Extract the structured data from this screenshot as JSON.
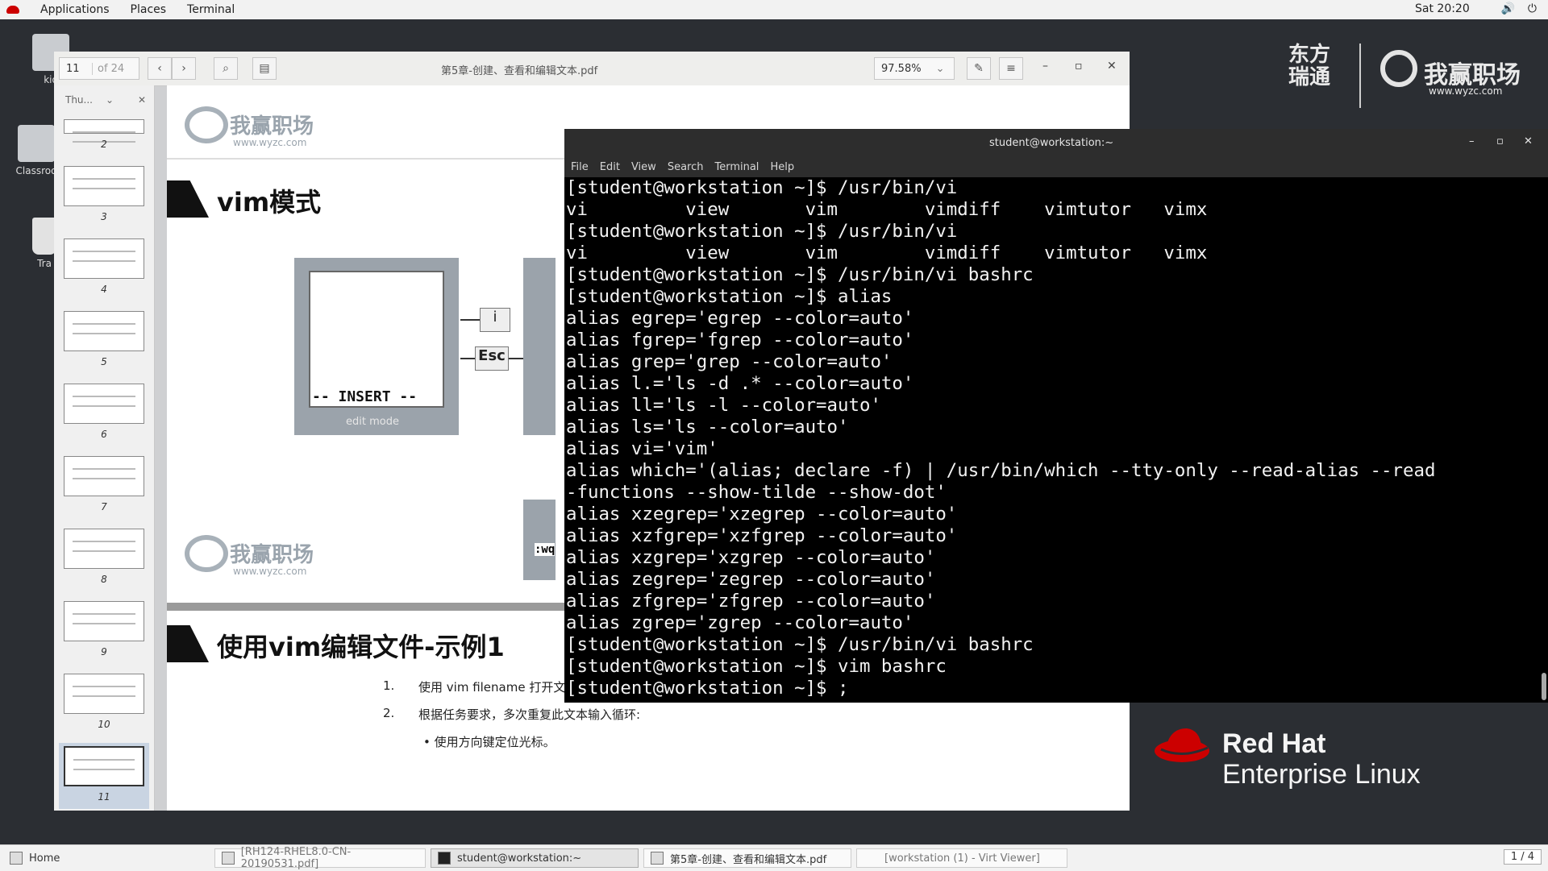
{
  "topbar": {
    "applications": "Applications",
    "places": "Places",
    "terminal": "Terminal",
    "clock": "Sat 20:20"
  },
  "desktop": {
    "icons": [
      "kio",
      "Classroo",
      "Tra"
    ]
  },
  "pdf": {
    "page_number": "11",
    "page_total": "of 24",
    "title": "第5章-创建、查看和编辑文本.pdf",
    "zoom": "97.58%",
    "sidebar_label": "Thu...",
    "thumb_numbers": [
      "2",
      "3",
      "4",
      "5",
      "6",
      "7",
      "8",
      "9",
      "10",
      "11"
    ],
    "watermark": "我赢职场",
    "watermark_url": "www.wyzc.com",
    "slide1_title": "vim模式",
    "insert_label": "-- INSERT --",
    "edit_mode": "edit mode",
    "key_i": "i",
    "key_esc": "Esc",
    "wq_label": ":wq",
    "slide2_title": "使用vim编辑文件-示例1",
    "step1_num": "1.",
    "step1": "使用 vim filename 打开文件。",
    "step2_num": "2.",
    "step2": "根据任务要求，多次重复此文本输入循环:",
    "step2_bullet": "• 使用方向键定位光标。"
  },
  "terminal": {
    "title": "student@workstation:~",
    "menu": [
      "File",
      "Edit",
      "View",
      "Search",
      "Terminal",
      "Help"
    ],
    "lines": [
      "[student@workstation ~]$ /usr/bin/vi",
      "vi         view       vim        vimdiff    vimtutor   vimx",
      "[student@workstation ~]$ /usr/bin/vi",
      "vi         view       vim        vimdiff    vimtutor   vimx",
      "[student@workstation ~]$ /usr/bin/vi bashrc",
      "[student@workstation ~]$ alias",
      "alias egrep='egrep --color=auto'",
      "alias fgrep='fgrep --color=auto'",
      "alias grep='grep --color=auto'",
      "alias l.='ls -d .* --color=auto'",
      "alias ll='ls -l --color=auto'",
      "alias ls='ls --color=auto'",
      "alias vi='vim'",
      "alias which='(alias; declare -f) | /usr/bin/which --tty-only --read-alias --read",
      "-functions --show-tilde --show-dot'",
      "alias xzegrep='xzegrep --color=auto'",
      "alias xzfgrep='xzfgrep --color=auto'",
      "alias xzgrep='xzgrep --color=auto'",
      "alias zegrep='zegrep --color=auto'",
      "alias zfgrep='zfgrep --color=auto'",
      "alias zgrep='zgrep --color=auto'",
      "[student@workstation ~]$ /usr/bin/vi bashrc",
      "[student@workstation ~]$ vim bashrc",
      "[student@workstation ~]$ ;"
    ]
  },
  "branding": {
    "cn1": "东方",
    "cn2": "瑞通",
    "cn3": "我赢职场",
    "cn_url": "www.wyzc.com",
    "rh_line1": "Red Hat",
    "rh_line2": "Enterprise Linux"
  },
  "taskbar": {
    "home": "Home",
    "tasks": [
      "[RH124-RHEL8.0-CN-20190531.pdf]",
      "student@workstation:~",
      "第5章-创建、查看和编辑文本.pdf",
      "[workstation (1) - Virt Viewer]"
    ],
    "workspace": "1 / 4"
  },
  "colors": {
    "desktop": "#2b2e33",
    "redhat": "#cc0000",
    "terminal_bg": "#000000"
  }
}
